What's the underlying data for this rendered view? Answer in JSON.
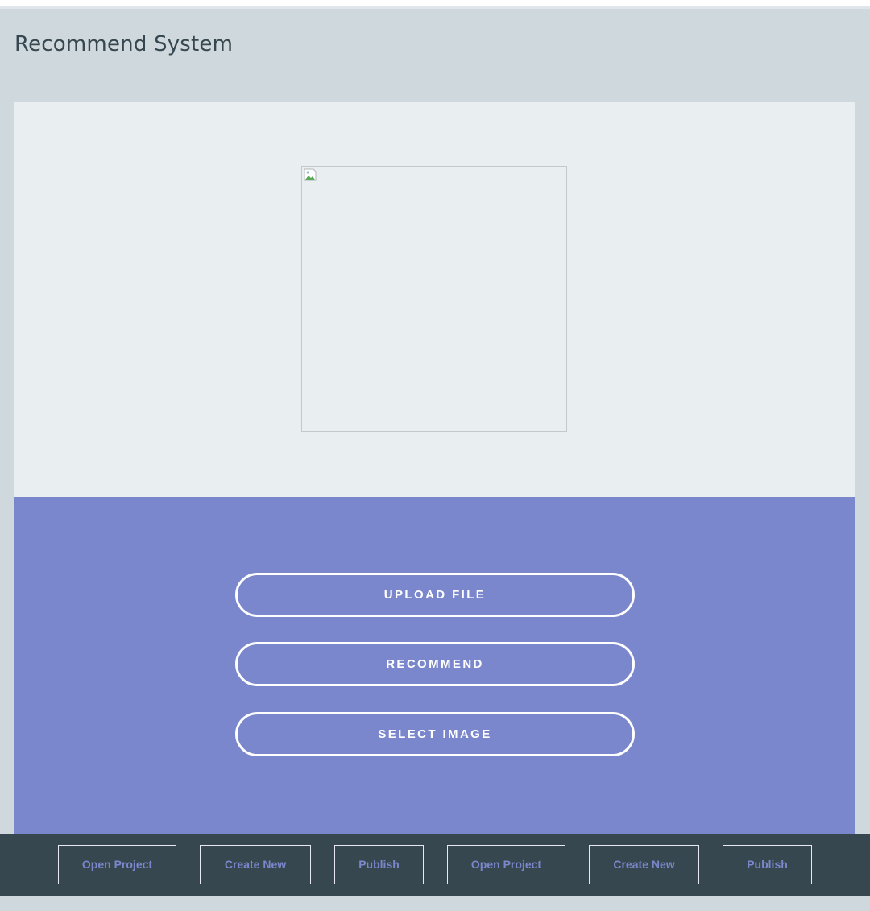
{
  "header": {
    "title": "Recommend System"
  },
  "preview": {
    "icon": "broken-image-icon"
  },
  "actions": {
    "upload_label": "UPLOAD FILE",
    "recommend_label": "RECOMMEND",
    "select_label": "SELECT IMAGE"
  },
  "footer": {
    "buttons": [
      {
        "label": "Open Project"
      },
      {
        "label": "Create New"
      },
      {
        "label": "Publish"
      },
      {
        "label": "Open Project"
      },
      {
        "label": "Create New"
      },
      {
        "label": "Publish"
      }
    ]
  },
  "colors": {
    "background": "#cfd8dc",
    "title": "#37474f",
    "image_panel": "#e9eef1",
    "accent": "#7a87cc",
    "footer": "#37474f",
    "button_border": "#ffffff"
  }
}
